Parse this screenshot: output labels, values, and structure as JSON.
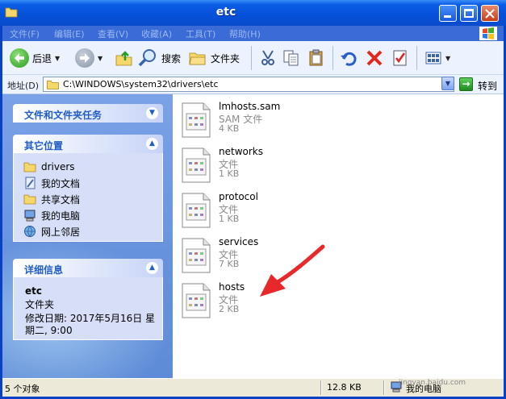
{
  "window": {
    "title": "etc"
  },
  "menu": [
    "文件(F)",
    "编辑(E)",
    "查看(V)",
    "收藏(A)",
    "工具(T)",
    "帮助(H)"
  ],
  "toolbar": {
    "back": "后退",
    "search": "搜索",
    "folders": "文件夹"
  },
  "address": {
    "label": "地址(D)",
    "path": "C:\\WINDOWS\\system32\\drivers\\etc",
    "go": "转到"
  },
  "tasks": {
    "title": "文件和文件夹任务"
  },
  "places": {
    "title": "其它位置",
    "items": [
      "drivers",
      "我的文档",
      "共享文档",
      "我的电脑",
      "网上邻居"
    ]
  },
  "details": {
    "title": "详细信息",
    "name": "etc",
    "type": "文件夹",
    "modified": "修改日期: 2017年5月16日 星期二, 9:00"
  },
  "files": [
    {
      "name": "lmhosts.sam",
      "type": "SAM 文件",
      "size": "4 KB"
    },
    {
      "name": "networks",
      "type": "文件",
      "size": "1 KB"
    },
    {
      "name": "protocol",
      "type": "文件",
      "size": "1 KB"
    },
    {
      "name": "services",
      "type": "文件",
      "size": "7 KB"
    },
    {
      "name": "hosts",
      "type": "文件",
      "size": "2 KB"
    }
  ],
  "status": {
    "count": "5 个对象",
    "size": "12.8 KB",
    "location": "我的电脑"
  },
  "watermark": {
    "brand": "Bai 经验",
    "url": "jingyan.baidu.com"
  },
  "colors": {
    "titlebar": "#0650d8",
    "leftpane": "#6d97e2",
    "annotation_arrow": "#e8282b"
  }
}
